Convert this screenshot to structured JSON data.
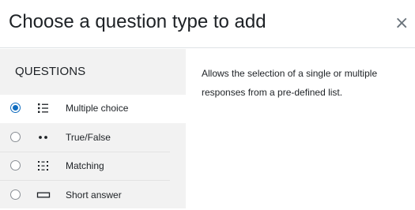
{
  "dialog": {
    "title": "Choose a question type to add",
    "close_symbol": "×",
    "close_icon": "close-icon"
  },
  "questions": {
    "section_label": "QUESTIONS",
    "selected_index": 0,
    "options": [
      {
        "label": "Multiple choice",
        "icon": "multiple-choice-icon",
        "selected": true
      },
      {
        "label": "True/False",
        "icon": "true-false-icon",
        "selected": false
      },
      {
        "label": "Matching",
        "icon": "matching-icon",
        "selected": false
      },
      {
        "label": "Short answer",
        "icon": "short-answer-icon",
        "selected": false
      }
    ]
  },
  "details": {
    "description": "Allows the selection of a single or multiple responses from a pre-defined list."
  },
  "colors": {
    "accent": "#0f6cbf",
    "panel_background": "#f2f2f2",
    "text": "#1d2125"
  }
}
